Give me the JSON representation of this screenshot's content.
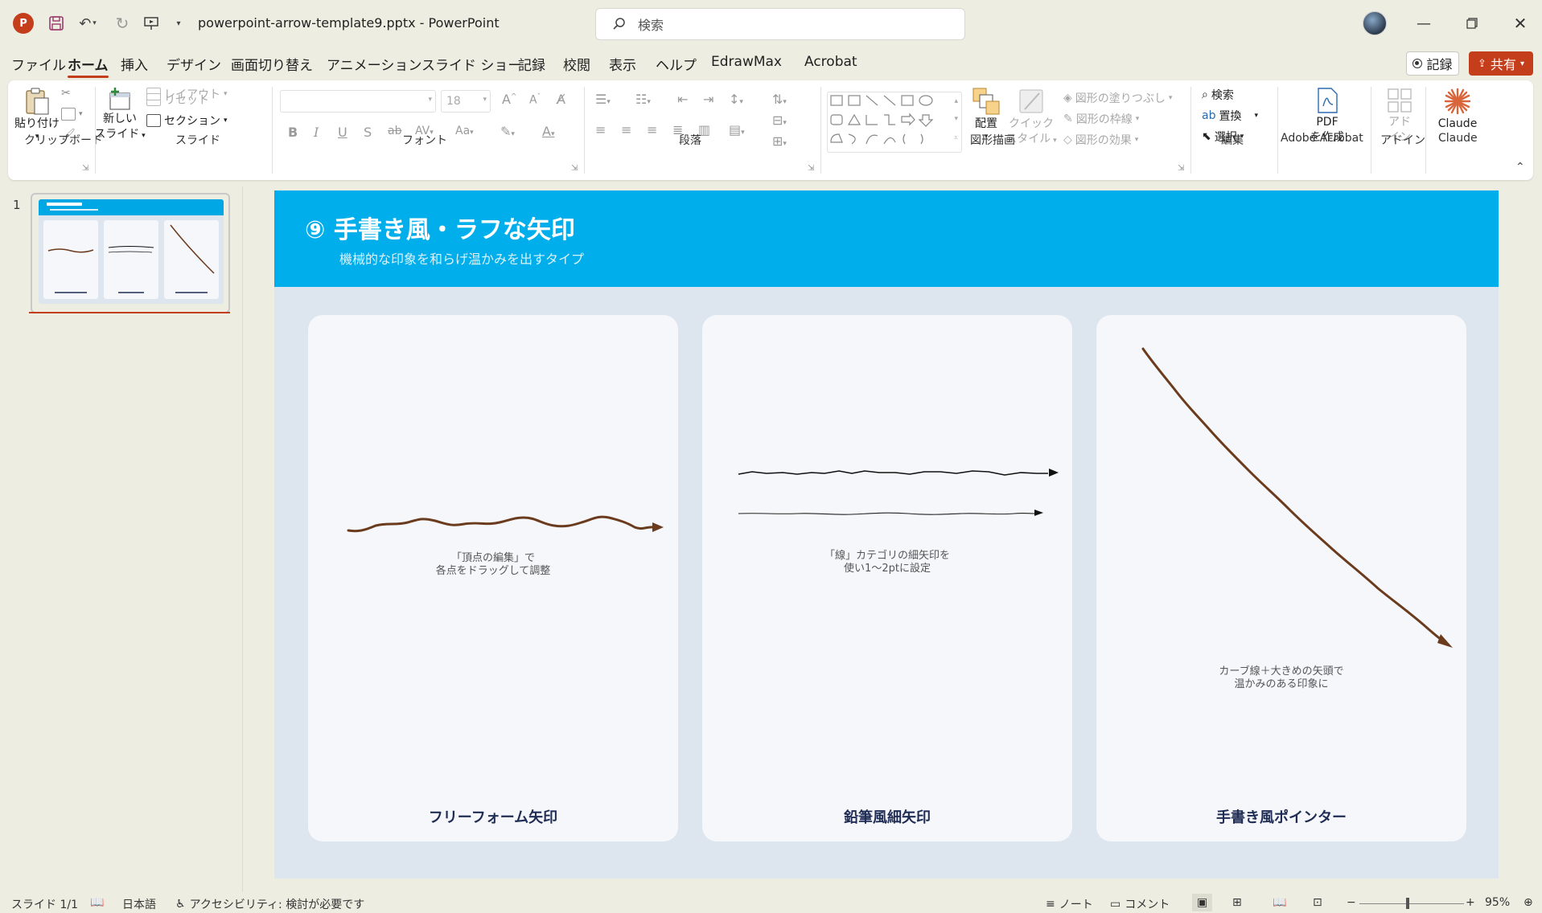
{
  "app": {
    "logo_letter": "P",
    "doc_title": "powerpoint-arrow-template9.pptx  -  PowerPoint",
    "search_placeholder": "検索"
  },
  "tabs": [
    "ファイル",
    "ホーム",
    "挿入",
    "デザイン",
    "画面切り替え",
    "アニメーション",
    "スライド ショー",
    "記録",
    "校閲",
    "表示",
    "ヘルプ",
    "EdrawMax",
    "Acrobat"
  ],
  "active_tab": "ホーム",
  "header_buttons": {
    "record": "記録",
    "share": "共有"
  },
  "ribbon": {
    "clipboard": {
      "paste": "貼り付け",
      "label": "クリップボード"
    },
    "slides": {
      "new_slide_line1": "新しい",
      "new_slide_line2": "スライド",
      "layout": "レイアウト",
      "reset": "リセット",
      "section": "セクション",
      "label": "スライド"
    },
    "font": {
      "size": "18",
      "label": "フォント"
    },
    "paragraph": {
      "label": "段落"
    },
    "drawing": {
      "arrange": "配置",
      "quick_style_line1": "クイック",
      "quick_style_line2": "スタイル",
      "fill": "図形の塗りつぶし",
      "outline": "図形の枠線",
      "effects": "図形の効果",
      "label": "図形描画"
    },
    "editing": {
      "find": "検索",
      "replace": "置換",
      "select": "選択",
      "label": "編集"
    },
    "acrobat": {
      "pdf_line1": "PDF",
      "pdf_line2": "を作成",
      "label": "Adobe Acrobat"
    },
    "addins": {
      "line1": "アド",
      "line2": "イン",
      "label": "アドイン"
    },
    "claude": {
      "button": "Claude",
      "label": "Claude"
    }
  },
  "thumbnail": {
    "number": "1"
  },
  "slide": {
    "badge": "⑨",
    "title": "手書き風・ラフな矢印",
    "subtitle": "機械的な印象を和らげ温かみを出すタイプ",
    "cards": [
      {
        "title": "フリーフォーム矢印",
        "note_line1": "「頂点の編集」で",
        "note_line2": "各点をドラッグして調整"
      },
      {
        "title": "鉛筆風細矢印",
        "note_line1": "「線」カテゴリの細矢印を",
        "note_line2": "使い1～2ptに設定"
      },
      {
        "title": "手書き風ポインター",
        "note_line1": "カーブ線＋大きめの矢頭で",
        "note_line2": "温かみのある印象に"
      }
    ]
  },
  "colors": {
    "accent": "#c43e1c",
    "header": "#00aeeb",
    "arrow_brown": "#6b3b1e",
    "title_navy": "#1f2d55"
  },
  "statusbar": {
    "slide_count": "スライド 1/1",
    "language": "日本語",
    "accessibility": "アクセシビリティ: 検討が必要です",
    "notes": "ノート",
    "comments": "コメント",
    "zoom": "95%"
  }
}
